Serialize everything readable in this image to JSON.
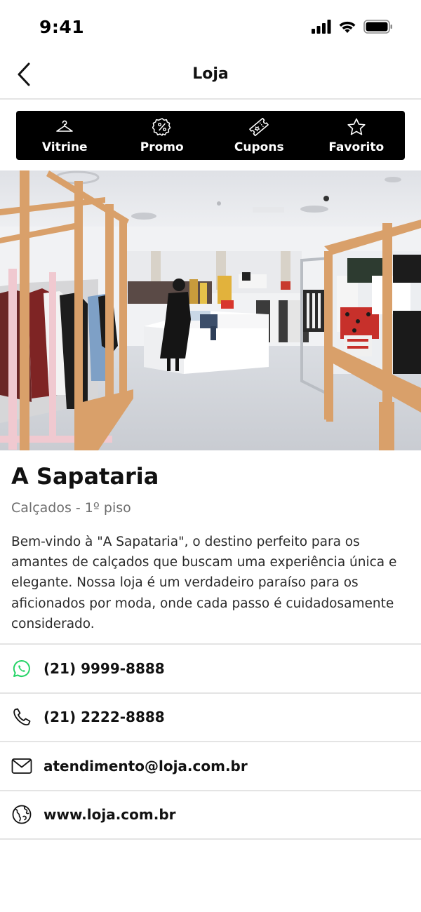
{
  "status_bar": {
    "time": "9:41"
  },
  "nav": {
    "title": "Loja"
  },
  "actions": [
    {
      "label": "Vitrine",
      "icon": "hanger-icon"
    },
    {
      "label": "Promo",
      "icon": "discount-badge-icon"
    },
    {
      "label": "Cupons",
      "icon": "ticket-icon"
    },
    {
      "label": "Favorito",
      "icon": "star-icon"
    }
  ],
  "store": {
    "name": "A Sapataria",
    "subtitle": "Calçados - 1º piso",
    "description": "Bem-vindo à \"A Sapataria\", o destino perfeito para os amantes de calçados que buscam uma experiência única e elegante. Nossa loja é um verdadeiro paraíso para os aficionados por moda, onde cada passo é cuidadosamente considerado."
  },
  "contacts": [
    {
      "icon": "whatsapp-icon",
      "value": "(21) 9999-8888",
      "color": "#25D366"
    },
    {
      "icon": "phone-icon",
      "value": "(21) 2222-8888"
    },
    {
      "icon": "mail-icon",
      "value": "atendimento@loja.com.br"
    },
    {
      "icon": "globe-icon",
      "value": "www.loja.com.br"
    }
  ]
}
